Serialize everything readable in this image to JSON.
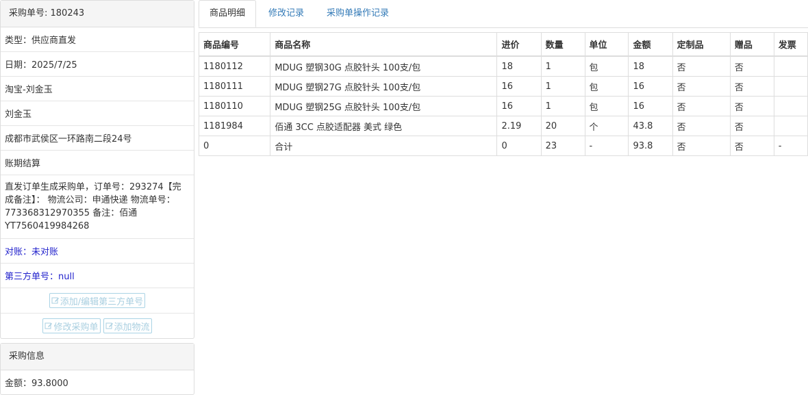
{
  "order": {
    "header": "采购单号: 180243",
    "type": "类型：供应商直发",
    "date": "日期：2025/7/25",
    "shop": "淘宝-刘金玉",
    "person": "刘金玉",
    "address": "成都市武侯区一环路南二段24号",
    "payment": "账期结算",
    "remark": "直发订单生成采购单，订单号：293274【完成备注】： 物流公司：申通快递 物流单号：773368312970355 备注：佰通YT7560419984268",
    "reconcile": "对账：未对账",
    "third_party": "第三方单号：null",
    "add_third_btn": "添加/编辑第三方单号",
    "modify_btn": "修改采购单",
    "add_logistics_btn": "添加物流"
  },
  "purchase_info": {
    "header": "采购信息",
    "amount": "金额：93.8000"
  },
  "tabs": [
    "商品明细",
    "修改记录",
    "采购单操作记录"
  ],
  "table": {
    "headers": [
      "商品编号",
      "商品名称",
      "进价",
      "数量",
      "单位",
      "金额",
      "定制品",
      "赠品",
      "发票"
    ],
    "rows": [
      [
        "1180112",
        "MDUG 塑钢30G 点胶针头 100支/包",
        "18",
        "1",
        "包",
        "18",
        "否",
        "否",
        ""
      ],
      [
        "1180111",
        "MDUG 塑钢27G 点胶针头 100支/包",
        "16",
        "1",
        "包",
        "16",
        "否",
        "否",
        ""
      ],
      [
        "1180110",
        "MDUG 塑钢25G 点胶针头 100支/包",
        "16",
        "1",
        "包",
        "16",
        "否",
        "否",
        ""
      ],
      [
        "1181984",
        "佰通 3CC 点胶适配器 美式 绿色",
        "2.19",
        "20",
        "个",
        "43.8",
        "否",
        "否",
        ""
      ],
      [
        "0",
        "合计",
        "0",
        "23",
        "-",
        "93.8",
        "否",
        "否",
        "-"
      ]
    ]
  },
  "colors": {
    "link": "#337ab7",
    "blue_text": "#2222cc",
    "panel_head_bg": "#f5f5f5",
    "border": "#dddddd"
  }
}
